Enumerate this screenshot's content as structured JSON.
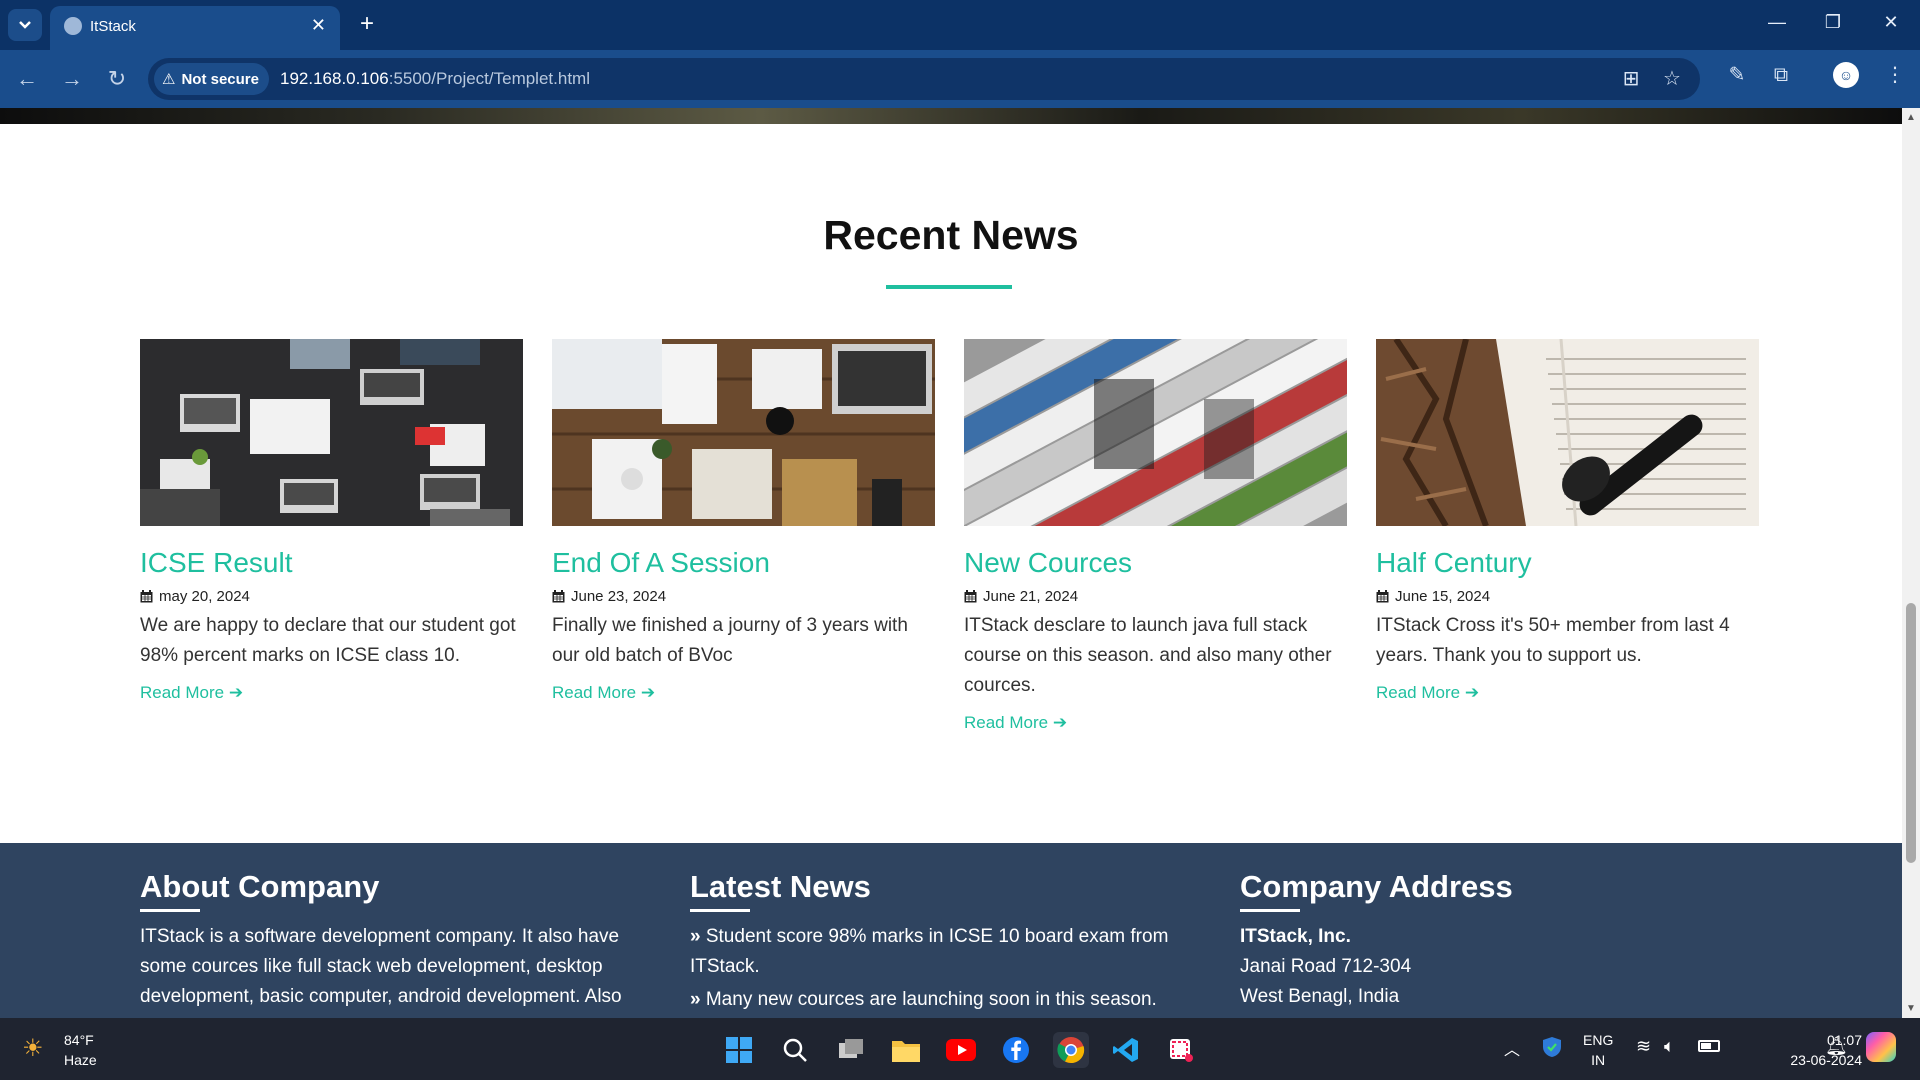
{
  "browser": {
    "tab_title": "ItStack",
    "not_secure_label": "Not secure",
    "url_host": "192.168.0.106",
    "url_rest": ":5500/Project/Templet.html",
    "accent": "#0c3266"
  },
  "news": {
    "heading": "Recent News",
    "cards": [
      {
        "title": "ICSE Result",
        "date": "may 20, 2024",
        "desc": "We are happy to declare that our student got 98% percent marks on ICSE class 10.",
        "more": "Read More"
      },
      {
        "title": "End Of A Session",
        "date": "June 23, 2024",
        "desc": "Finally we finished a journy of 3 years with our old batch of BVoc",
        "more": "Read More"
      },
      {
        "title": "New Cources",
        "date": "June 21, 2024",
        "desc": "ITStack desclare to launch java full stack course on this season. and also many other cources.",
        "more": "Read More"
      },
      {
        "title": "Half Century",
        "date": "June 15, 2024",
        "desc": "ITStack Cross it's 50+ member from last 4 years. Thank you to support us.",
        "more": "Read More"
      }
    ]
  },
  "footer": {
    "about": {
      "heading": "About Company",
      "text": "ITStack is a software development company. It also have some cources like full stack web development, desktop development, basic computer, android development. Also"
    },
    "latest": {
      "heading": "Latest News",
      "items": [
        "Student score 98% marks in ICSE 10 board exam from ITStack.",
        "Many new cources are launching soon in this season."
      ]
    },
    "address": {
      "heading": "Company Address",
      "name": "ITStack, Inc.",
      "line1": "Janai Road 712-304",
      "line2": "West Benagl, India"
    }
  },
  "taskbar": {
    "temp": "84°F",
    "condition": "Haze",
    "lang_top": "ENG",
    "lang_bottom": "IN",
    "time": "01:07",
    "date": "23-06-2024"
  },
  "colors": {
    "accent": "#1fbf9f",
    "footer_bg": "#2f4460"
  }
}
